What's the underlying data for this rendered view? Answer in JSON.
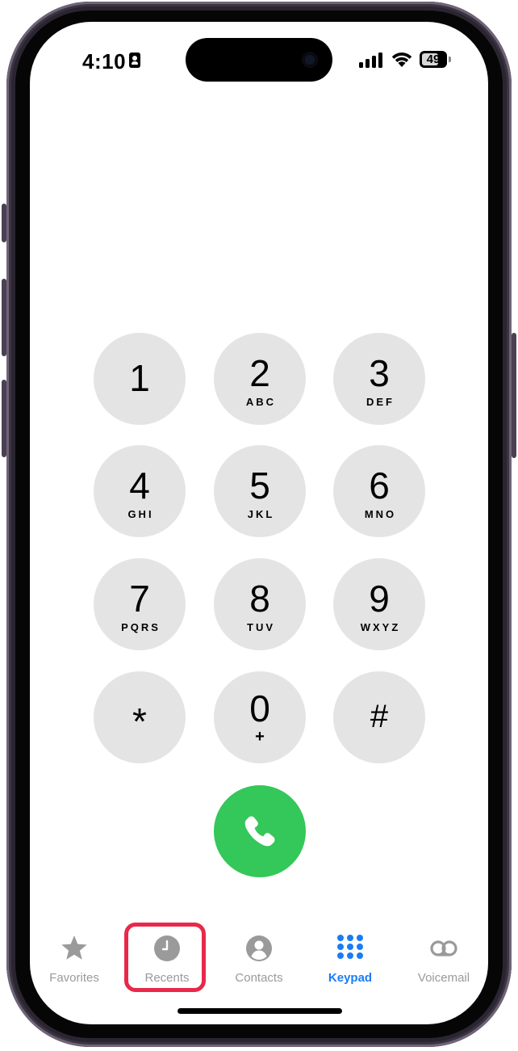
{
  "status_bar": {
    "time": "4:10",
    "battery_percent": "49"
  },
  "keypad": {
    "keys": [
      {
        "digit": "1",
        "letters": ""
      },
      {
        "digit": "2",
        "letters": "ABC"
      },
      {
        "digit": "3",
        "letters": "DEF"
      },
      {
        "digit": "4",
        "letters": "GHI"
      },
      {
        "digit": "5",
        "letters": "JKL"
      },
      {
        "digit": "6",
        "letters": "MNO"
      },
      {
        "digit": "7",
        "letters": "PQRS"
      },
      {
        "digit": "8",
        "letters": "TUV"
      },
      {
        "digit": "9",
        "letters": "WXYZ"
      },
      {
        "digit": "*",
        "letters": ""
      },
      {
        "digit": "0",
        "letters": "+"
      },
      {
        "digit": "#",
        "letters": ""
      }
    ],
    "call_icon": "phone-icon",
    "key_color": "#e4e4e4",
    "call_color": "#34c759"
  },
  "tab_bar": {
    "tabs": [
      {
        "label": "Favorites",
        "icon": "star-icon",
        "active": false
      },
      {
        "label": "Recents",
        "icon": "clock-icon",
        "active": false,
        "highlighted": true
      },
      {
        "label": "Contacts",
        "icon": "person-icon",
        "active": false
      },
      {
        "label": "Keypad",
        "icon": "keypad-icon",
        "active": true
      },
      {
        "label": "Voicemail",
        "icon": "voicemail-icon",
        "active": false
      }
    ],
    "active_color": "#1a7cf5",
    "inactive_color": "#9a9a9a",
    "highlight_color": "#e8294a"
  }
}
